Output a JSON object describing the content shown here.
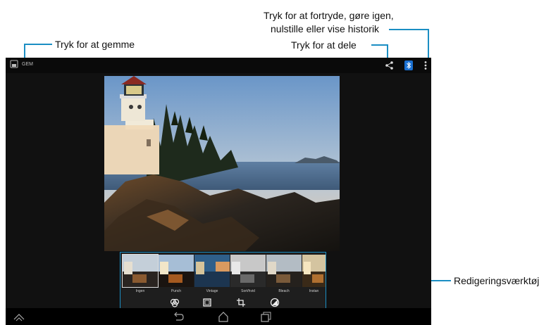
{
  "callouts": {
    "save": "Tryk for at gemme",
    "undo_line1": "Tryk for at fortryde, gøre igen,",
    "undo_line2": "nulstille eller vise historik",
    "share": "Tryk for at dele",
    "tools": "Redigeringsværktøj"
  },
  "action_bar": {
    "save_label": "GEM"
  },
  "filters": [
    {
      "label": "Ingen"
    },
    {
      "label": "Punch"
    },
    {
      "label": "Vintage"
    },
    {
      "label": "Sort/hvid"
    },
    {
      "label": "Bleach"
    },
    {
      "label": "Instan"
    }
  ],
  "colors": {
    "accent": "#1b8ec3",
    "background": "#111111",
    "bluetooth": "#1a6fd0"
  },
  "icons": [
    "save-icon",
    "share-icon",
    "bluetooth-icon",
    "overflow-menu-icon",
    "filter-icon",
    "frame-icon",
    "crop-icon",
    "adjust-icon",
    "back-icon",
    "home-icon",
    "recent-apps-icon",
    "collapse-icon"
  ]
}
